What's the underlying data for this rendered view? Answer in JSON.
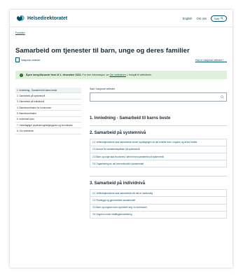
{
  "header": {
    "logo_text": "Helsedirektoratet",
    "lang_link": "English",
    "about_link": "Om oss",
    "search_button": "Søk"
  },
  "breadcrumb": "Forsiden",
  "page": {
    "title": "Samarbeid om tjenester til barn, unge og deres familier",
    "doc_type": "Nasjonal veileder",
    "what_is_link": "Hva er nasjonal veileder?"
  },
  "notice": {
    "bold": "Åpen innspillsrunde frem til 1. desember 2022.",
    "text": " For mer informasjon, se ",
    "link": "Om veilederen",
    "after": " > Innspill til veilederen."
  },
  "toc": [
    "1. Innledning - Samarbeid til barns beste",
    "2. Samarbeid på systemnivå",
    "3. Samarbeid på individnivå",
    "4. Barnekoordinator for kommunen",
    "5. Barnekoordinator",
    "6. Individuell plan",
    "7. Helsefaglige/ psykiske/oppfølgingsplan og koordinator",
    "8. Om veilederen"
  ],
  "search": {
    "label": "Søk i nasjonal veileder"
  },
  "sections": [
    {
      "heading": "1. Inniedning - Samarbeid til barns beste",
      "items": []
    },
    {
      "heading": "2. Samarbeid på systemnivå",
      "items": [
        "2.1 Velferdstjenestene skal samarbeide utover oppfølgingen av det enkelte barn, ungdom og deres familie",
        "2.2 Ansvar for samarbeidsplikten på systemnivå",
        "2.3 Barn og unge skal involveres i arbeid med samarbeid på systemnivå",
        "2.4 Organisering av det tverrsektorielle samarbeidet"
      ]
    },
    {
      "heading": "3. Samarbeid på individnivå",
      "items": [
        "3.1 Velferdstjenestene skal samarbeide når det er nødvendig",
        "3.2 Planlegge og gjennomføre samarbeidet",
        "3.3 Barn og ungdom som oppholder seg i to kommuner",
        "3.4 Ungdom under straffegjennomføring"
      ]
    }
  ],
  "colors": {
    "brand": "#025169",
    "notice_bg": "#dff0db",
    "notice_icon": "#1e6b1e"
  }
}
